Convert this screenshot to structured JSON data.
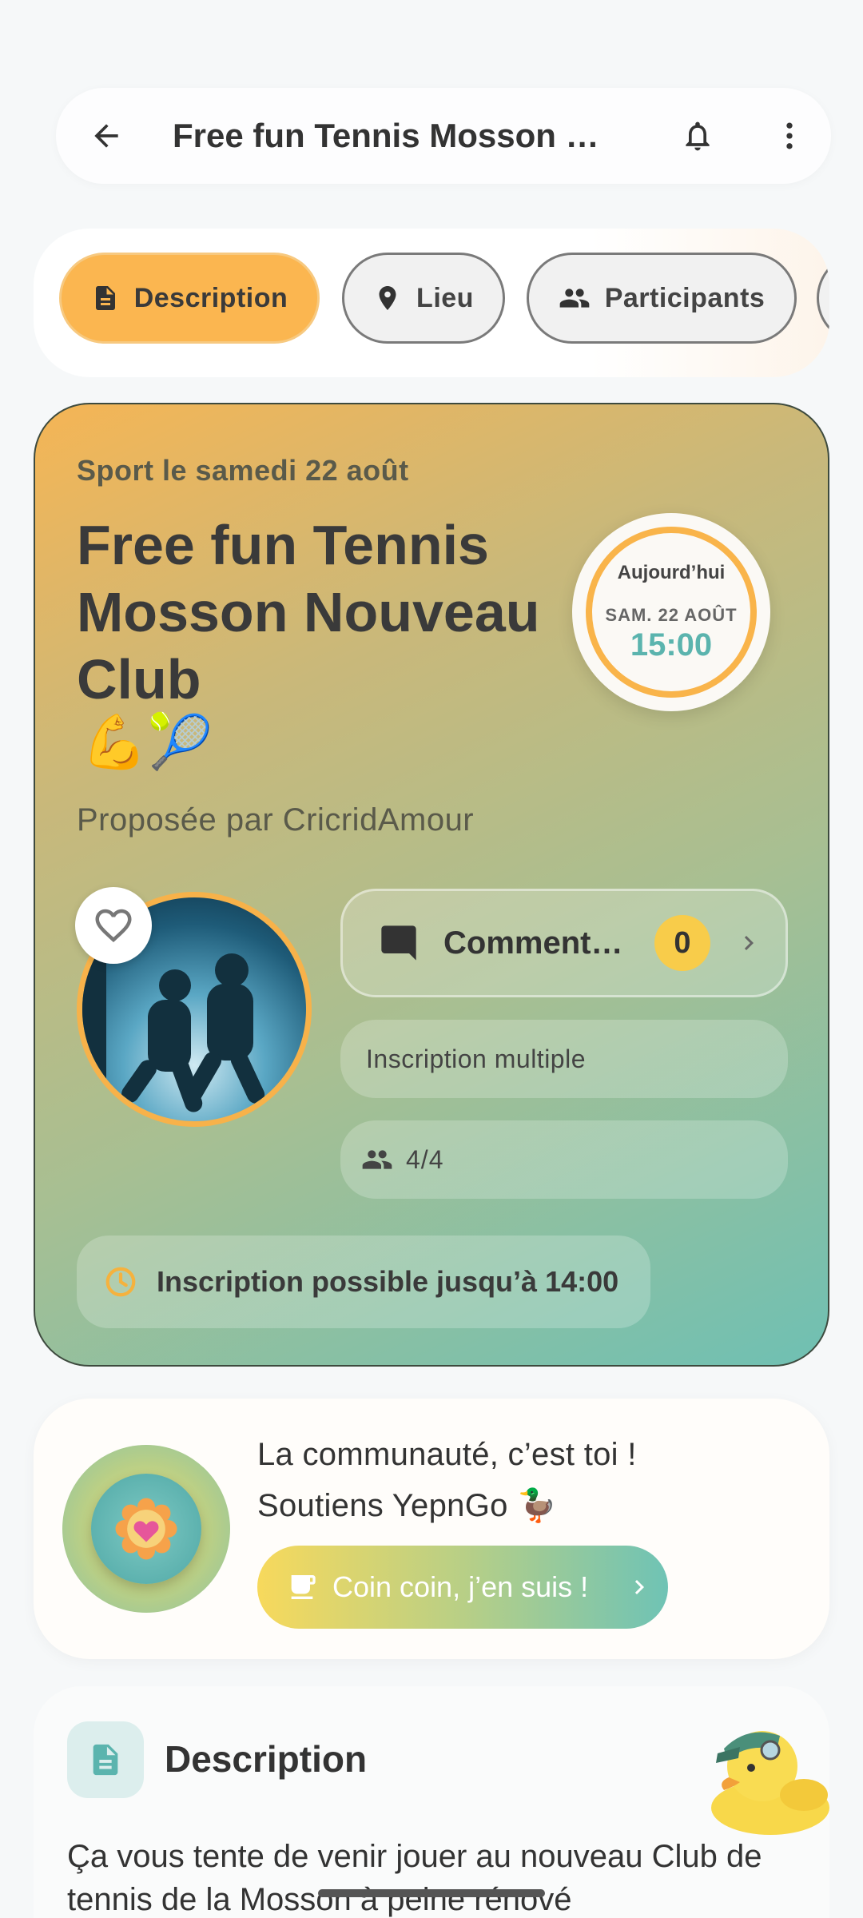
{
  "header": {
    "title": "Free fun Tennis Mosson Nouveau Club 💪🎾"
  },
  "tabs": [
    {
      "label": "Description",
      "icon": "document-icon",
      "active": true
    },
    {
      "label": "Lieu",
      "icon": "location-pin-icon",
      "active": false
    },
    {
      "label": "Participants",
      "icon": "people-icon",
      "active": false
    }
  ],
  "event": {
    "subtitle": "Sport le samedi 22 août",
    "title": "Free fun Tennis Mosson Nouveau Club",
    "title_emojis": "💪🎾",
    "organizer": "Proposée par CricridAmour",
    "date_badge": {
      "today": "Aujourd’hui",
      "date": "SAM. 22 AOÛT",
      "time": "15:00"
    },
    "comments_label": "Commentaires",
    "comments_count": "0",
    "multiple_label": "Inscription multiple",
    "participants": "4/4",
    "deadline": "Inscription possible jusqu’à 14:00"
  },
  "support": {
    "line1": "La communauté, c’est toi !",
    "line2": "Soutiens YepnGo 🦆",
    "cta": "Coin coin, j’en suis !"
  },
  "description": {
    "title": "Description",
    "text": "Ça vous tente de venir jouer au nouveau Club de tennis de la Mosson à peine rénové"
  },
  "colors": {
    "accent_orange": "#fbb650",
    "accent_teal": "#6fc0b3",
    "badge_yellow": "#f8cc4a"
  }
}
